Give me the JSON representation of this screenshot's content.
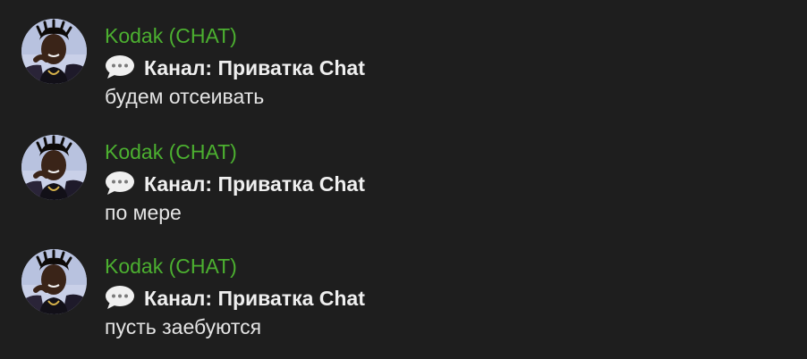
{
  "theme": {
    "background": "#1e1e1e",
    "sender_color": "#4cb030",
    "text_color": "#e4e4e4"
  },
  "messages": [
    {
      "sender": "Kodak (CHAT)",
      "avatar_icon": "user-avatar",
      "channel_icon": "speech-bubble-icon",
      "channel": "Канал: Приватка Chat",
      "text": "будем отсеивать"
    },
    {
      "sender": "Kodak (CHAT)",
      "avatar_icon": "user-avatar",
      "channel_icon": "speech-bubble-icon",
      "channel": "Канал: Приватка Chat",
      "text": "по мере"
    },
    {
      "sender": "Kodak (CHAT)",
      "avatar_icon": "user-avatar",
      "channel_icon": "speech-bubble-icon",
      "channel": "Канал: Приватка Chat",
      "text": "пусть заебуются"
    }
  ]
}
